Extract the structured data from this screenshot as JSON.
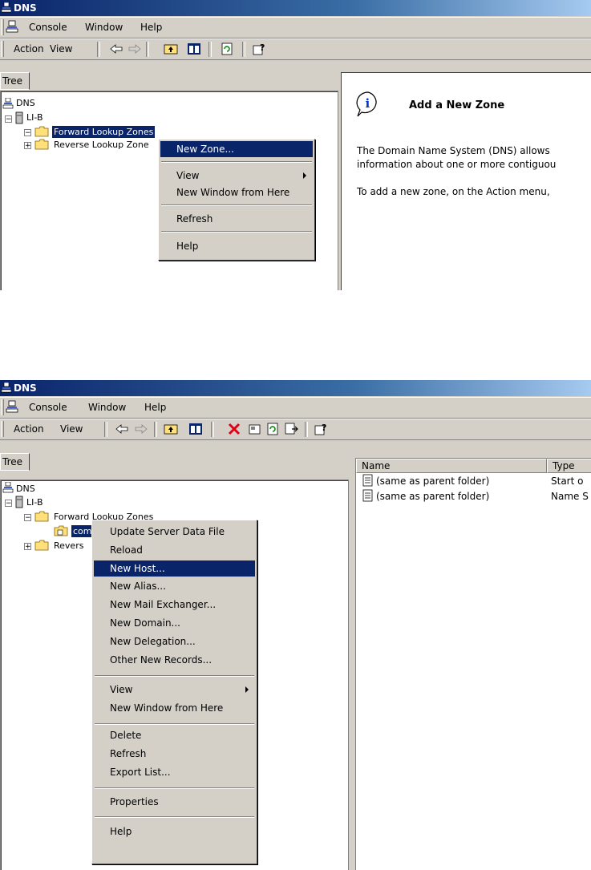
{
  "top": {
    "title": "DNS",
    "menu": [
      "Console",
      "Window",
      "Help"
    ],
    "toolbar_menu": [
      "Action",
      "View"
    ],
    "tree_tab": "Tree",
    "tree": {
      "root": "DNS",
      "server": "LI-B",
      "forward": "Forward Lookup Zones",
      "reverse": "Reverse Lookup Zone"
    },
    "context_menu": {
      "new_zone": "New Zone...",
      "view": "View",
      "new_window": "New Window from Here",
      "refresh": "Refresh",
      "help": "Help"
    },
    "info": {
      "heading": "Add a New Zone",
      "line1": "The Domain Name System (DNS) allows",
      "line2": "information about one or more contiguou",
      "line3": "To add a new zone, on the Action menu,"
    }
  },
  "bottom": {
    "title": "DNS",
    "menu": [
      "Console",
      "Window",
      "Help"
    ],
    "toolbar_menu": [
      "Action",
      "View"
    ],
    "tree_tab": "Tree",
    "tree": {
      "root": "DNS",
      "server": "LI-B",
      "forward": "Forward Lookup Zones",
      "zone": "com",
      "reverse": "Revers"
    },
    "context_menu": {
      "update": "Update Server Data File",
      "reload": "Reload",
      "new_host": "New Host...",
      "new_alias": "New Alias...",
      "new_mx": "New Mail Exchanger...",
      "new_domain": "New Domain...",
      "new_delegation": "New Delegation...",
      "other_records": "Other New Records...",
      "view": "View",
      "new_window": "New Window from Here",
      "delete": "Delete",
      "refresh": "Refresh",
      "export": "Export List...",
      "properties": "Properties",
      "help": "Help"
    },
    "list": {
      "columns": [
        "Name",
        "Type"
      ],
      "rows": [
        {
          "name": "(same as parent folder)",
          "type": "Start o"
        },
        {
          "name": "(same as parent folder)",
          "type": "Name S"
        }
      ]
    }
  },
  "colors": {
    "title_bar": "#0a246a",
    "highlight": "#0a246a",
    "face": "#d4d0c8",
    "delete_red": "#e0001a"
  },
  "icons": [
    "dns-server-icon",
    "folder-icon",
    "info-icon",
    "back-arrow-icon",
    "forward-arrow-icon",
    "up-folder-icon",
    "show-tree-icon",
    "refresh-icon",
    "help-icon",
    "delete-icon",
    "properties-icon",
    "export-icon",
    "record-icon",
    "zone-icon"
  ]
}
